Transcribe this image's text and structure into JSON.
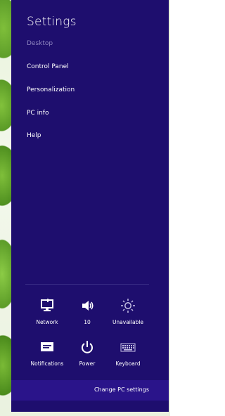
{
  "charm": {
    "title": "Settings",
    "context_app": "Desktop",
    "items": [
      {
        "label": "Control Panel"
      },
      {
        "label": "Personalization"
      },
      {
        "label": "PC info"
      },
      {
        "label": "Help"
      }
    ],
    "quick_settings": [
      {
        "label": "Network",
        "icon": "network-icon"
      },
      {
        "label": "10",
        "icon": "volume-icon"
      },
      {
        "label": "Unavailable",
        "icon": "brightness-icon"
      },
      {
        "label": "Notifications",
        "icon": "notifications-icon"
      },
      {
        "label": "Power",
        "icon": "power-icon"
      },
      {
        "label": "Keyboard",
        "icon": "keyboard-icon"
      }
    ],
    "footer_link": "Change PC settings"
  },
  "colors": {
    "charm_bg": "#1e0e6e",
    "footer_bg": "#2a148a",
    "dim_text": "#8f86c0"
  }
}
